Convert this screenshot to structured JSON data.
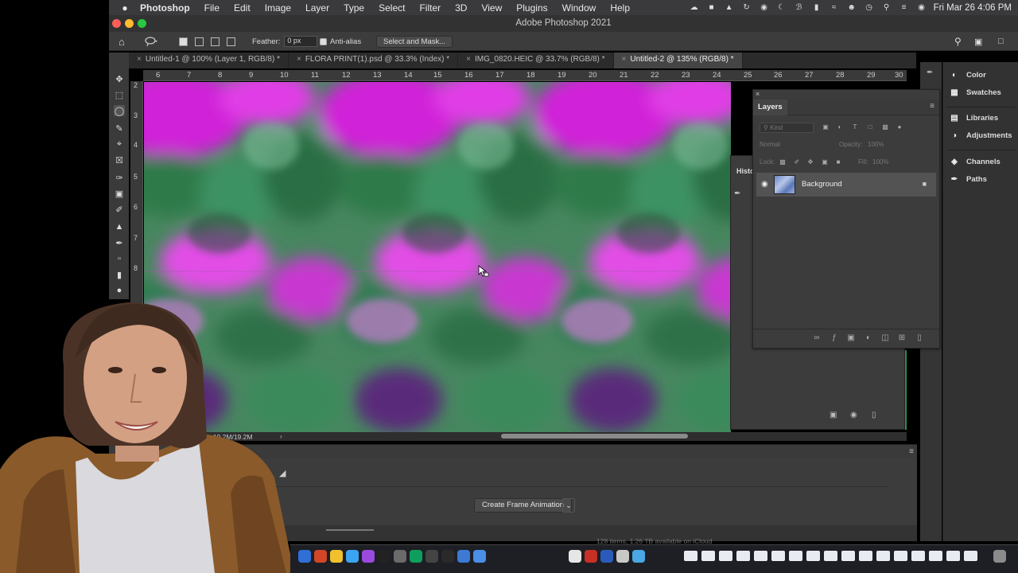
{
  "menubar": {
    "app_name": "Photoshop",
    "items": [
      "File",
      "Edit",
      "Image",
      "Layer",
      "Type",
      "Select",
      "Filter",
      "3D",
      "View",
      "Plugins",
      "Window",
      "Help"
    ],
    "clock": "Fri Mar 26  4:06 PM"
  },
  "window": {
    "title": "Adobe Photoshop 2021"
  },
  "options_bar": {
    "feather_label": "Feather:",
    "feather_value": "0 px",
    "antialias_label": "Anti-alias",
    "select_mask_label": "Select and Mask..."
  },
  "doc_tabs": [
    {
      "label": "Untitled-1 @ 100% (Layer 1, RGB/8) *",
      "active": false
    },
    {
      "label": "FLORA PRINT(1).psd @ 33.3% (Index) *",
      "active": false
    },
    {
      "label": "IMG_0820.HEIC @ 33.7% (RGB/8) *",
      "active": false
    },
    {
      "label": "Untitled-2 @ 135% (RGB/8) *",
      "active": true
    }
  ],
  "ruler": {
    "top_ticks": [
      "6",
      "7",
      "8",
      "9",
      "10",
      "11",
      "12",
      "13",
      "14",
      "15",
      "16",
      "17",
      "18",
      "19",
      "20",
      "21",
      "22",
      "23",
      "24",
      "25",
      "26",
      "27",
      "28",
      "29",
      "30"
    ],
    "left_ticks": [
      "2",
      "3",
      "4",
      "5",
      "6",
      "7",
      "8"
    ]
  },
  "status": {
    "doc_size": "Doc: 19.2M/19.2M"
  },
  "timeline": {
    "create_label": "Create Frame Animation"
  },
  "history_panel": {
    "tab": "Histo"
  },
  "layers_panel": {
    "tab": "Layers",
    "filter_placeholder": "Kind",
    "blend_mode": "Normal",
    "opacity_label": "Opacity:",
    "opacity_value": "100%",
    "lock_label": "Lock:",
    "fill_label": "Fill:",
    "fill_value": "100%",
    "layer_name": "Background"
  },
  "right_dock": {
    "items": [
      {
        "label": "Color",
        "icon": "color-wheel-icon"
      },
      {
        "label": "Swatches",
        "icon": "swatches-grid-icon"
      },
      {
        "label": "Libraries",
        "icon": "libraries-icon"
      },
      {
        "label": "Adjustments",
        "icon": "adjustments-icon"
      },
      {
        "label": "Channels",
        "icon": "channels-icon"
      },
      {
        "label": "Paths",
        "icon": "paths-pen-icon"
      }
    ]
  },
  "icloud_note": "128 items, 1.26 TB available on iCloud",
  "colors": {
    "accent_magenta": "#c93fd6",
    "accent_green": "#3f8a5e",
    "panel_bg": "#3c3c3c",
    "menubar_bg": "#3a3a3c"
  }
}
